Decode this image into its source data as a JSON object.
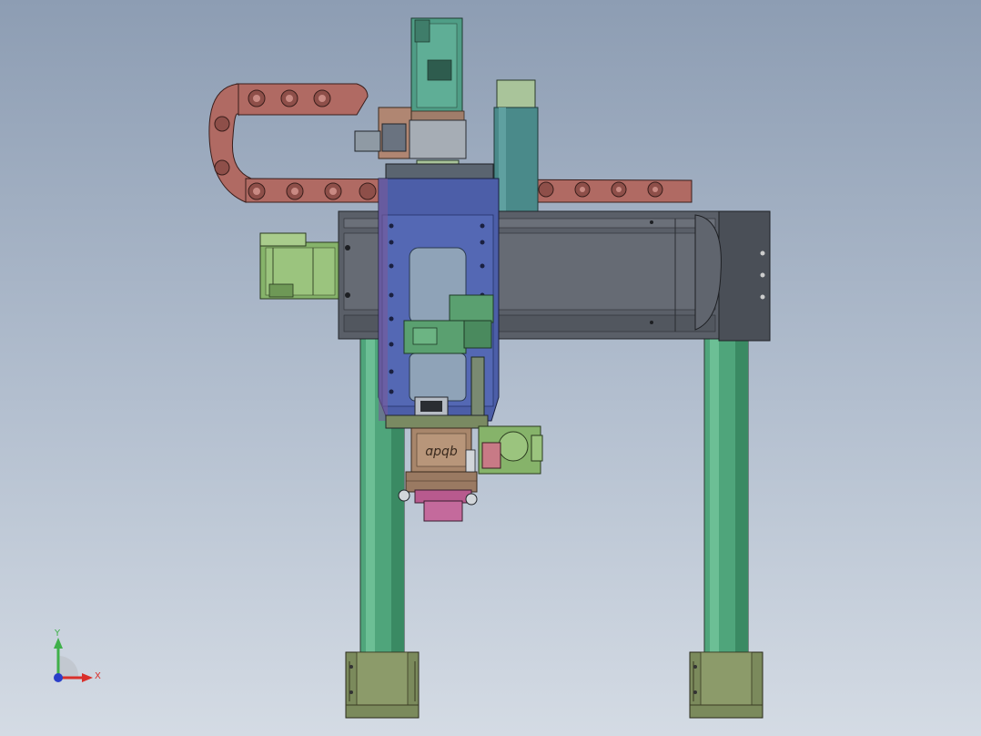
{
  "viewport": {
    "background_top": "#8d9db3",
    "background_bottom": "#d4dbe4"
  },
  "model": {
    "engraved_text": "ɑpqb",
    "colors": {
      "column": "#4fa57b",
      "column_dark": "#2f7d58",
      "foot": "#7b8a5c",
      "rail": "#5a5f68",
      "end_plate": "#4a4f57",
      "drag_chain": "#b06a63",
      "carriage_plate": "#4c5ea8",
      "servo_motor": "#86b36a",
      "top_motor": "#4f9d86",
      "pink_part": "#b85a8e",
      "tan_block": "#a8866b"
    }
  },
  "triad": {
    "x_label": "X",
    "y_label": "Y",
    "x_color": "#d9302b",
    "y_color": "#3fb04a",
    "z_color": "#2a3fc9"
  }
}
